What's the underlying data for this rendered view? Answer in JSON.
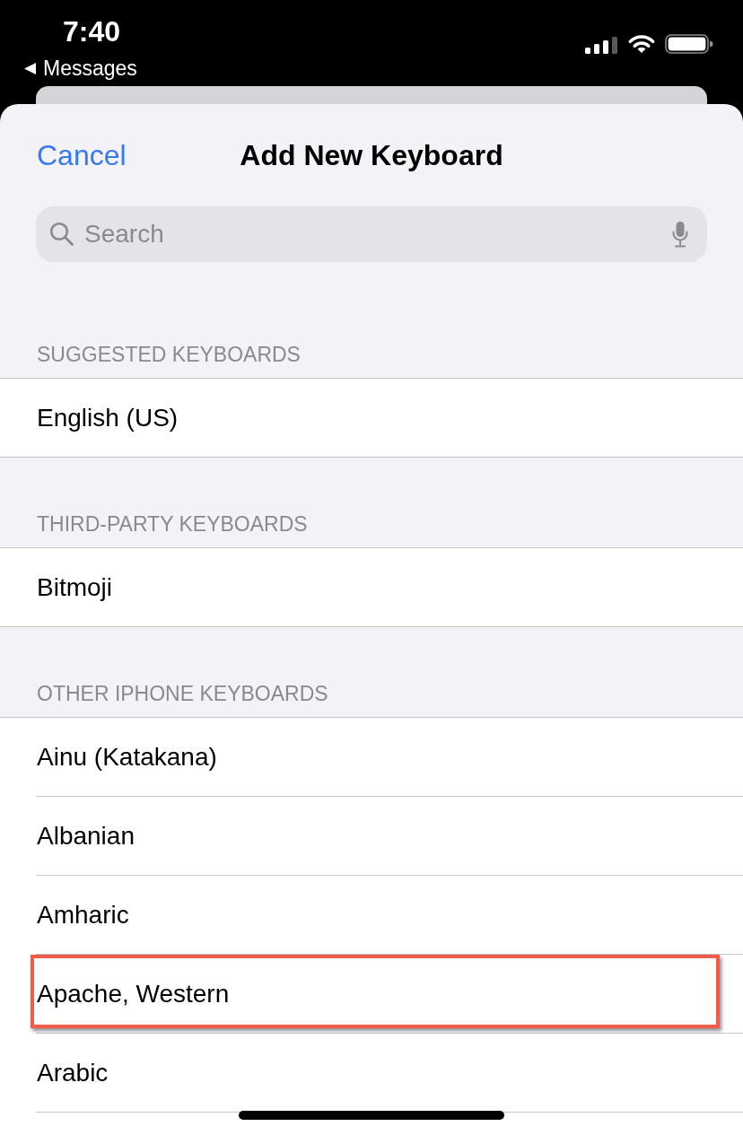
{
  "status_bar": {
    "time": "7:40",
    "back_label": "Messages"
  },
  "nav": {
    "cancel": "Cancel",
    "title": "Add New Keyboard"
  },
  "search": {
    "placeholder": "Search"
  },
  "sections": [
    {
      "header": "SUGGESTED KEYBOARDS",
      "rows": [
        {
          "label": "English (US)",
          "highlighted": false
        }
      ]
    },
    {
      "header": "THIRD-PARTY KEYBOARDS",
      "rows": [
        {
          "label": "Bitmoji",
          "highlighted": false
        }
      ]
    },
    {
      "header": "OTHER IPHONE KEYBOARDS",
      "rows": [
        {
          "label": "Ainu (Katakana)",
          "highlighted": false
        },
        {
          "label": "Albanian",
          "highlighted": false
        },
        {
          "label": "Amharic",
          "highlighted": false
        },
        {
          "label": "Apache, Western",
          "highlighted": true
        },
        {
          "label": "Arabic",
          "highlighted": false
        }
      ]
    }
  ]
}
